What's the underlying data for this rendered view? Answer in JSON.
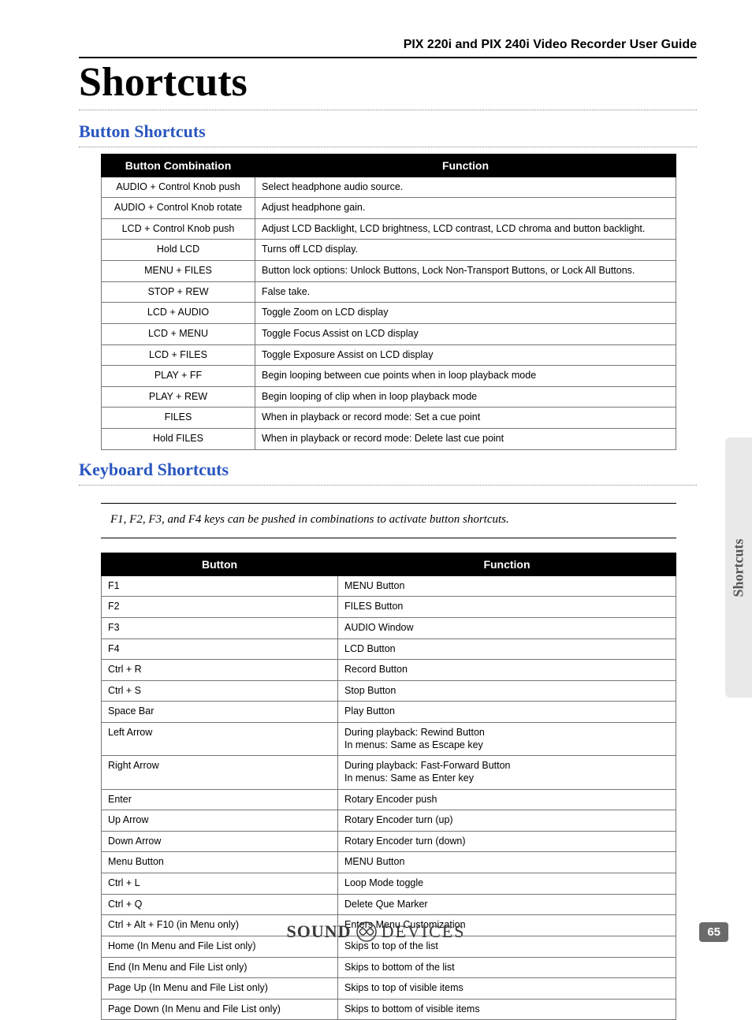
{
  "header": {
    "guide_title": "PIX 220i and PIX 240i Video Recorder User Guide"
  },
  "page_title": "Shortcuts",
  "side_tab": "Shortcuts",
  "page_number": "65",
  "brand": {
    "sound": "SOUND",
    "devices": "DEVICES"
  },
  "button_section": {
    "heading": "Button Shortcuts",
    "headers": [
      "Button Combination",
      "Function"
    ],
    "rows": [
      {
        "combo": "AUDIO + Control Knob push",
        "func": "Select headphone audio source."
      },
      {
        "combo": "AUDIO + Control Knob rotate",
        "func": "Adjust headphone gain."
      },
      {
        "combo": "LCD + Control Knob push",
        "func": "Adjust LCD Backlight, LCD brightness, LCD contrast, LCD chroma and button backlight."
      },
      {
        "combo": "Hold LCD",
        "func": "Turns off LCD display."
      },
      {
        "combo": "MENU + FILES",
        "func": "Button lock options: Unlock Buttons, Lock Non-Transport Buttons, or Lock All Buttons."
      },
      {
        "combo": "STOP + REW",
        "func": "False take."
      },
      {
        "combo": "LCD + AUDIO",
        "func": "Toggle Zoom on LCD display"
      },
      {
        "combo": "LCD + MENU",
        "func": "Toggle Focus Assist on LCD display"
      },
      {
        "combo": "LCD + FILES",
        "func": "Toggle Exposure Assist on LCD display"
      },
      {
        "combo": "PLAY + FF",
        "func": "Begin looping between cue points when in loop playback mode"
      },
      {
        "combo": "PLAY + REW",
        "func": "Begin looping of clip when in loop playback mode"
      },
      {
        "combo": "FILES",
        "func": "When in playback or record mode: Set a cue point"
      },
      {
        "combo": "Hold FILES",
        "func": "When in playback or record mode: Delete last cue point"
      }
    ]
  },
  "keyboard_section": {
    "heading": "Keyboard Shortcuts",
    "note": "F1, F2, F3, and F4 keys can be pushed in combinations to activate button shortcuts.",
    "headers": [
      "Button",
      "Function"
    ],
    "rows": [
      {
        "btn": "F1",
        "func": "MENU Button"
      },
      {
        "btn": "F2",
        "func": "FILES Button"
      },
      {
        "btn": "F3",
        "func": "AUDIO Window"
      },
      {
        "btn": "F4",
        "func": "LCD Button"
      },
      {
        "btn": "Ctrl + R",
        "func": "Record Button"
      },
      {
        "btn": "Ctrl + S",
        "func": "Stop Button"
      },
      {
        "btn": "Space Bar",
        "func": "Play Button"
      },
      {
        "btn": "Left Arrow",
        "func": "During playback: Rewind Button\nIn menus: Same as Escape key"
      },
      {
        "btn": "Right Arrow",
        "func": "During playback: Fast-Forward Button\nIn menus: Same as Enter key"
      },
      {
        "btn": "Enter",
        "func": "Rotary Encoder push"
      },
      {
        "btn": "Up Arrow",
        "func": "Rotary Encoder turn (up)"
      },
      {
        "btn": "Down Arrow",
        "func": "Rotary Encoder turn (down)"
      },
      {
        "btn": "Menu Button",
        "func": "MENU Button"
      },
      {
        "btn": "Ctrl + L",
        "func": "Loop Mode toggle"
      },
      {
        "btn": "Ctrl + Q",
        "func": "Delete Que Marker"
      },
      {
        "btn": "Ctrl + Alt + F10 (in Menu only)",
        "func": "Enters Menu Customization"
      },
      {
        "btn": "Home (In Menu and File List only)",
        "func": "Skips to top of the list"
      },
      {
        "btn": "End  (In Menu and File List only)",
        "func": "Skips to bottom of the list"
      },
      {
        "btn": "Page Up  (In Menu and File List only)",
        "func": "Skips to top of visible items"
      },
      {
        "btn": "Page Down (In Menu and File List only)",
        "func": "Skips to bottom of visible items"
      }
    ]
  }
}
